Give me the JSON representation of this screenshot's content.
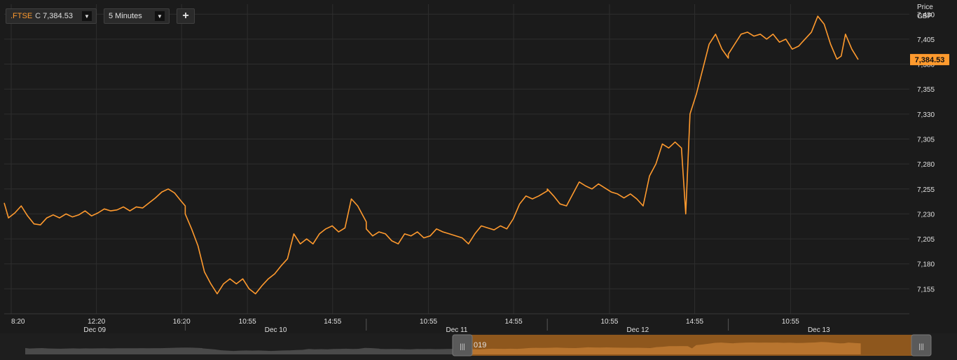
{
  "toolbar": {
    "symbol": ".FTSE",
    "close_prefix": "C",
    "close_value": "7,384.53",
    "interval": "5 Minutes",
    "add_label": "+"
  },
  "axis": {
    "y_title_line1": "Price",
    "y_title_line2": "GBP",
    "current_price_label": "7,384.53"
  },
  "navigator": {
    "fragment_text": "019"
  },
  "colors": {
    "series": "#ff9a2e",
    "background": "#1b1b1b",
    "grid": "#2e2e2e",
    "text": "#e0e0e0",
    "badge": "#ff9a2e"
  },
  "chart_data": {
    "type": "line",
    "title": "",
    "xlabel": "",
    "ylabel": "Price GBP",
    "ylim": [
      7130,
      7440
    ],
    "y_ticks": [
      7155,
      7180,
      7205,
      7230,
      7255,
      7280,
      7305,
      7330,
      7355,
      7380,
      7405,
      7430
    ],
    "y_tick_labels": [
      "7,155",
      "7,180",
      "7,205",
      "7,230",
      "7,255",
      "7,280",
      "7,305",
      "7,330",
      "7,355",
      "7,380",
      "7,405",
      "7,430"
    ],
    "x_tick_labels": [
      {
        "label": "8:20",
        "day": 0,
        "hour": 8.33
      },
      {
        "label": "12:20",
        "day": 0,
        "hour": 12.33
      },
      {
        "label": "16:20",
        "day": 0,
        "hour": 16.33
      },
      {
        "label": "10:55",
        "day": 1,
        "hour": 10.92
      },
      {
        "label": "14:55",
        "day": 1,
        "hour": 14.92
      },
      {
        "label": "10:55",
        "day": 2,
        "hour": 10.92
      },
      {
        "label": "14:55",
        "day": 2,
        "hour": 14.92
      },
      {
        "label": "10:55",
        "day": 3,
        "hour": 10.92
      },
      {
        "label": "14:55",
        "day": 3,
        "hour": 14.92
      },
      {
        "label": "10:55",
        "day": 4,
        "hour": 10.92
      }
    ],
    "x_day_labels": [
      {
        "label": "Dec 09",
        "day": 0
      },
      {
        "label": "Dec 10",
        "day": 1
      },
      {
        "label": "Dec 11",
        "day": 2
      },
      {
        "label": "Dec 12",
        "day": 3
      },
      {
        "label": "Dec 13",
        "day": 4
      }
    ],
    "series": [
      {
        "values": [
          [
            0,
            8.0,
            7241
          ],
          [
            0,
            8.2,
            7226
          ],
          [
            0,
            8.5,
            7231
          ],
          [
            0,
            8.8,
            7238
          ],
          [
            0,
            9.1,
            7228
          ],
          [
            0,
            9.4,
            7220
          ],
          [
            0,
            9.7,
            7219
          ],
          [
            0,
            10.0,
            7226
          ],
          [
            0,
            10.3,
            7229
          ],
          [
            0,
            10.6,
            7226
          ],
          [
            0,
            10.9,
            7230
          ],
          [
            0,
            11.2,
            7227
          ],
          [
            0,
            11.5,
            7229
          ],
          [
            0,
            11.8,
            7233
          ],
          [
            0,
            12.1,
            7228
          ],
          [
            0,
            12.4,
            7231
          ],
          [
            0,
            12.7,
            7235
          ],
          [
            0,
            13.0,
            7233
          ],
          [
            0,
            13.3,
            7234
          ],
          [
            0,
            13.6,
            7237
          ],
          [
            0,
            13.9,
            7233
          ],
          [
            0,
            14.2,
            7237
          ],
          [
            0,
            14.5,
            7236
          ],
          [
            0,
            14.8,
            7241
          ],
          [
            0,
            15.1,
            7246
          ],
          [
            0,
            15.4,
            7252
          ],
          [
            0,
            15.7,
            7255
          ],
          [
            0,
            16.0,
            7251
          ],
          [
            0,
            16.3,
            7243
          ],
          [
            0,
            16.5,
            7238
          ],
          [
            1,
            8.0,
            7230
          ],
          [
            1,
            8.3,
            7215
          ],
          [
            1,
            8.6,
            7198
          ],
          [
            1,
            8.9,
            7172
          ],
          [
            1,
            9.2,
            7160
          ],
          [
            1,
            9.5,
            7150
          ],
          [
            1,
            9.8,
            7160
          ],
          [
            1,
            10.1,
            7165
          ],
          [
            1,
            10.4,
            7160
          ],
          [
            1,
            10.7,
            7165
          ],
          [
            1,
            11.0,
            7155
          ],
          [
            1,
            11.3,
            7150
          ],
          [
            1,
            11.6,
            7158
          ],
          [
            1,
            11.9,
            7165
          ],
          [
            1,
            12.2,
            7170
          ],
          [
            1,
            12.5,
            7178
          ],
          [
            1,
            12.8,
            7185
          ],
          [
            1,
            13.1,
            7210
          ],
          [
            1,
            13.4,
            7200
          ],
          [
            1,
            13.7,
            7205
          ],
          [
            1,
            14.0,
            7200
          ],
          [
            1,
            14.3,
            7210
          ],
          [
            1,
            14.6,
            7215
          ],
          [
            1,
            14.9,
            7218
          ],
          [
            1,
            15.2,
            7212
          ],
          [
            1,
            15.5,
            7216
          ],
          [
            1,
            15.8,
            7245
          ],
          [
            1,
            16.1,
            7238
          ],
          [
            1,
            16.5,
            7222
          ],
          [
            2,
            8.0,
            7215
          ],
          [
            2,
            8.3,
            7208
          ],
          [
            2,
            8.6,
            7212
          ],
          [
            2,
            8.9,
            7210
          ],
          [
            2,
            9.2,
            7203
          ],
          [
            2,
            9.5,
            7200
          ],
          [
            2,
            9.8,
            7210
          ],
          [
            2,
            10.1,
            7208
          ],
          [
            2,
            10.4,
            7212
          ],
          [
            2,
            10.7,
            7206
          ],
          [
            2,
            11.0,
            7208
          ],
          [
            2,
            11.3,
            7215
          ],
          [
            2,
            11.6,
            7212
          ],
          [
            2,
            11.9,
            7210
          ],
          [
            2,
            12.2,
            7208
          ],
          [
            2,
            12.5,
            7206
          ],
          [
            2,
            12.8,
            7200
          ],
          [
            2,
            13.1,
            7210
          ],
          [
            2,
            13.4,
            7218
          ],
          [
            2,
            13.7,
            7216
          ],
          [
            2,
            14.0,
            7214
          ],
          [
            2,
            14.3,
            7218
          ],
          [
            2,
            14.6,
            7215
          ],
          [
            2,
            14.9,
            7225
          ],
          [
            2,
            15.2,
            7240
          ],
          [
            2,
            15.5,
            7248
          ],
          [
            2,
            15.8,
            7245
          ],
          [
            2,
            16.1,
            7248
          ],
          [
            2,
            16.5,
            7253
          ],
          [
            3,
            8.0,
            7255
          ],
          [
            3,
            8.3,
            7248
          ],
          [
            3,
            8.6,
            7240
          ],
          [
            3,
            8.9,
            7238
          ],
          [
            3,
            9.2,
            7250
          ],
          [
            3,
            9.5,
            7262
          ],
          [
            3,
            9.8,
            7258
          ],
          [
            3,
            10.1,
            7255
          ],
          [
            3,
            10.4,
            7260
          ],
          [
            3,
            10.7,
            7256
          ],
          [
            3,
            11.0,
            7252
          ],
          [
            3,
            11.3,
            7250
          ],
          [
            3,
            11.6,
            7246
          ],
          [
            3,
            11.9,
            7250
          ],
          [
            3,
            12.2,
            7245
          ],
          [
            3,
            12.5,
            7238
          ],
          [
            3,
            12.8,
            7268
          ],
          [
            3,
            13.1,
            7280
          ],
          [
            3,
            13.4,
            7300
          ],
          [
            3,
            13.7,
            7296
          ],
          [
            3,
            14.0,
            7302
          ],
          [
            3,
            14.3,
            7296
          ],
          [
            3,
            14.5,
            7230
          ],
          [
            3,
            14.7,
            7330
          ],
          [
            3,
            15.0,
            7350
          ],
          [
            3,
            15.3,
            7375
          ],
          [
            3,
            15.6,
            7400
          ],
          [
            3,
            15.9,
            7410
          ],
          [
            3,
            16.2,
            7395
          ],
          [
            3,
            16.5,
            7386
          ],
          [
            4,
            8.0,
            7390
          ],
          [
            4,
            8.3,
            7400
          ],
          [
            4,
            8.6,
            7410
          ],
          [
            4,
            8.9,
            7412
          ],
          [
            4,
            9.2,
            7408
          ],
          [
            4,
            9.5,
            7410
          ],
          [
            4,
            9.8,
            7405
          ],
          [
            4,
            10.1,
            7410
          ],
          [
            4,
            10.4,
            7402
          ],
          [
            4,
            10.7,
            7405
          ],
          [
            4,
            11.0,
            7395
          ],
          [
            4,
            11.3,
            7398
          ],
          [
            4,
            11.6,
            7405
          ],
          [
            4,
            11.9,
            7412
          ],
          [
            4,
            12.2,
            7428
          ],
          [
            4,
            12.5,
            7420
          ],
          [
            4,
            12.8,
            7400
          ],
          [
            4,
            13.1,
            7385
          ],
          [
            4,
            13.3,
            7388
          ],
          [
            4,
            13.5,
            7410
          ],
          [
            4,
            13.8,
            7395
          ],
          [
            4,
            14.1,
            7384.53
          ]
        ]
      }
    ]
  }
}
